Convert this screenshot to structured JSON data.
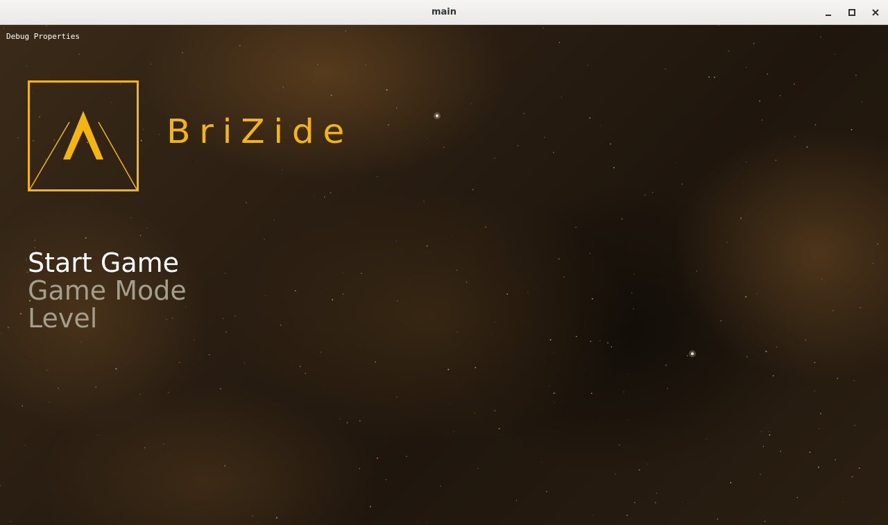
{
  "window": {
    "title": "main"
  },
  "debug": {
    "label": "Debug Properties"
  },
  "game": {
    "title": "BriZide",
    "logo_icon": "arrow-chevron-logo-icon"
  },
  "menu": {
    "items": [
      {
        "label": "Start Game",
        "selected": true
      },
      {
        "label": "Game Mode",
        "selected": false
      },
      {
        "label": "Level",
        "selected": false
      }
    ]
  },
  "colors": {
    "accent": "#f5b50f",
    "menu_selected": "#ffffff",
    "menu_unselected": "#a39f8c",
    "background": "#2a1e12"
  }
}
